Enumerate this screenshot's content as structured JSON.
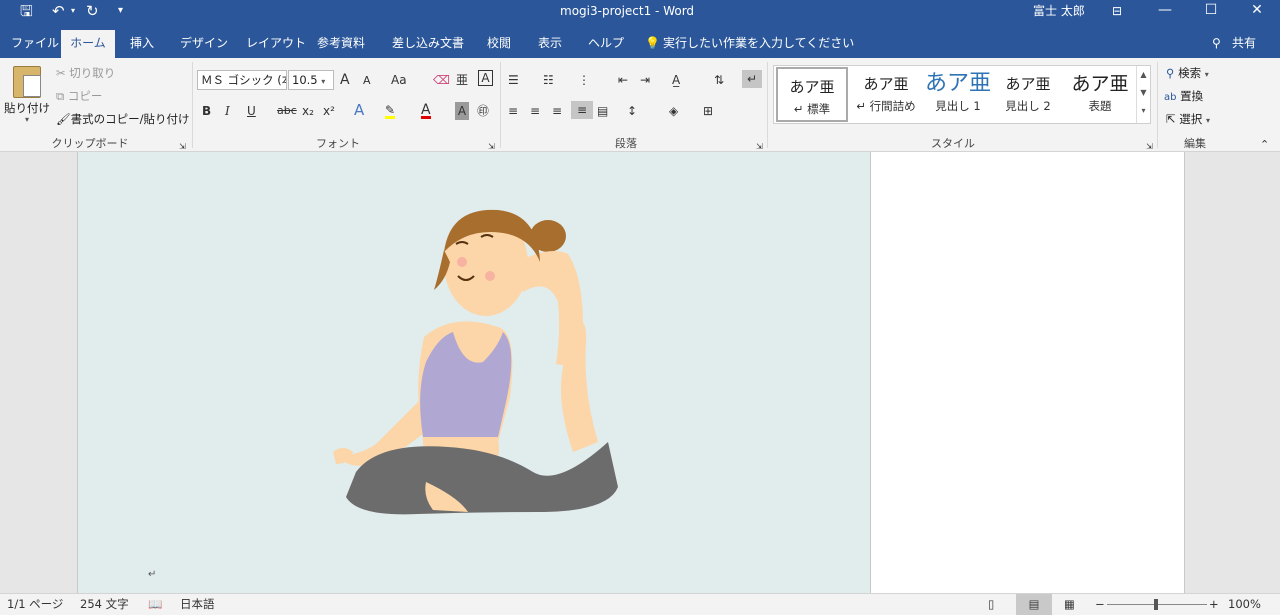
{
  "titlebar": {
    "title": "mogi3-project1 - Word",
    "user": "富士 太郎"
  },
  "tabs": [
    "ファイル",
    "ホーム",
    "挿入",
    "デザイン",
    "レイアウト",
    "参考資料",
    "差し込み文書",
    "校閲",
    "表示",
    "ヘルプ"
  ],
  "active_tab": "ホーム",
  "tell_me": "実行したい作業を入力してください",
  "share": "共有",
  "clipboard": {
    "paste": "貼り付け",
    "cut": "切り取り",
    "copy": "コピー",
    "format_painter": "書式のコピー/貼り付け",
    "group": "クリップボード"
  },
  "font": {
    "name": "ＭＳ ゴシック (本",
    "size": "10.5",
    "group": "フォント",
    "bold": "B",
    "italic": "I",
    "underline": "U",
    "strike": "abc",
    "sub": "x₂",
    "sup": "x²",
    "grow": "A",
    "shrink": "A",
    "case": "Aa"
  },
  "paragraph": {
    "group": "段落"
  },
  "styles": {
    "group": "スタイル",
    "items": [
      {
        "preview": "あア亜",
        "name": "↵ 標準"
      },
      {
        "preview": "あア亜",
        "name": "↵ 行間詰め"
      },
      {
        "preview": "あア亜",
        "name": "見出し 1"
      },
      {
        "preview": "あア亜",
        "name": "見出し 2"
      },
      {
        "preview": "あア亜",
        "name": "表題"
      }
    ]
  },
  "editing": {
    "find": "検索",
    "replace": "置換",
    "select": "選択",
    "group": "編集"
  },
  "status": {
    "page": "1/1 ページ",
    "words": "254 文字",
    "language": "日本語",
    "zoom": "100%"
  },
  "colors": {
    "accent": "#2b579a",
    "ribbon": "#f3f3f3",
    "page_bg": "#e1ecec"
  }
}
